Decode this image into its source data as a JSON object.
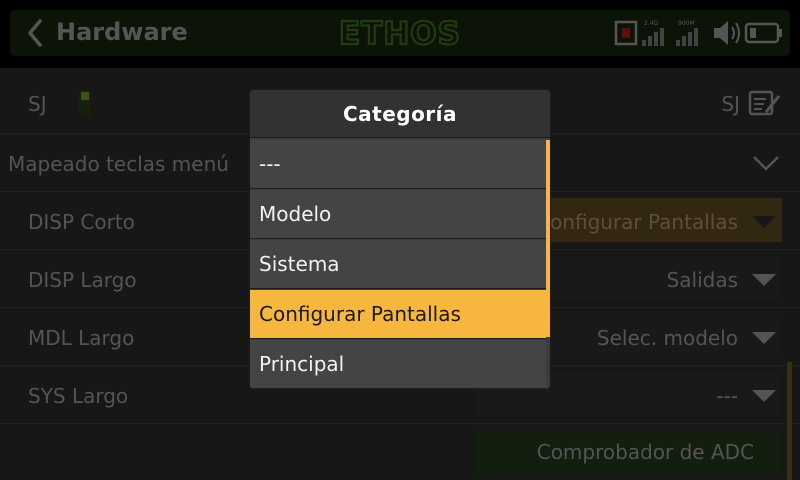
{
  "header": {
    "title": "Hardware",
    "logo_text": "ETHOS",
    "status_text_top": "2.4G",
    "status_text_top2": "900M"
  },
  "rows": {
    "sj": {
      "label": "SJ",
      "value": "SJ"
    },
    "section": {
      "label": "Mapeado teclas menú"
    },
    "disp_corto": {
      "label": "DISP Corto",
      "value": "Configurar Pantallas"
    },
    "disp_largo": {
      "label": "DISP Largo",
      "value": "Salidas"
    },
    "mdl_largo": {
      "label": "MDL Largo",
      "value": "Selec. modelo"
    },
    "sys_largo": {
      "label": "SYS Largo",
      "value": "---"
    },
    "adc": {
      "value": "Comprobador de ADC"
    }
  },
  "modal": {
    "title": "Categoría",
    "options": [
      "---",
      "Modelo",
      "Sistema",
      "Configurar Pantallas",
      "Principal"
    ],
    "selected_index": 3
  },
  "colors": {
    "accent": "#f7b63d",
    "header_green": "#15260d",
    "logo_green": "#3d6b1e"
  }
}
